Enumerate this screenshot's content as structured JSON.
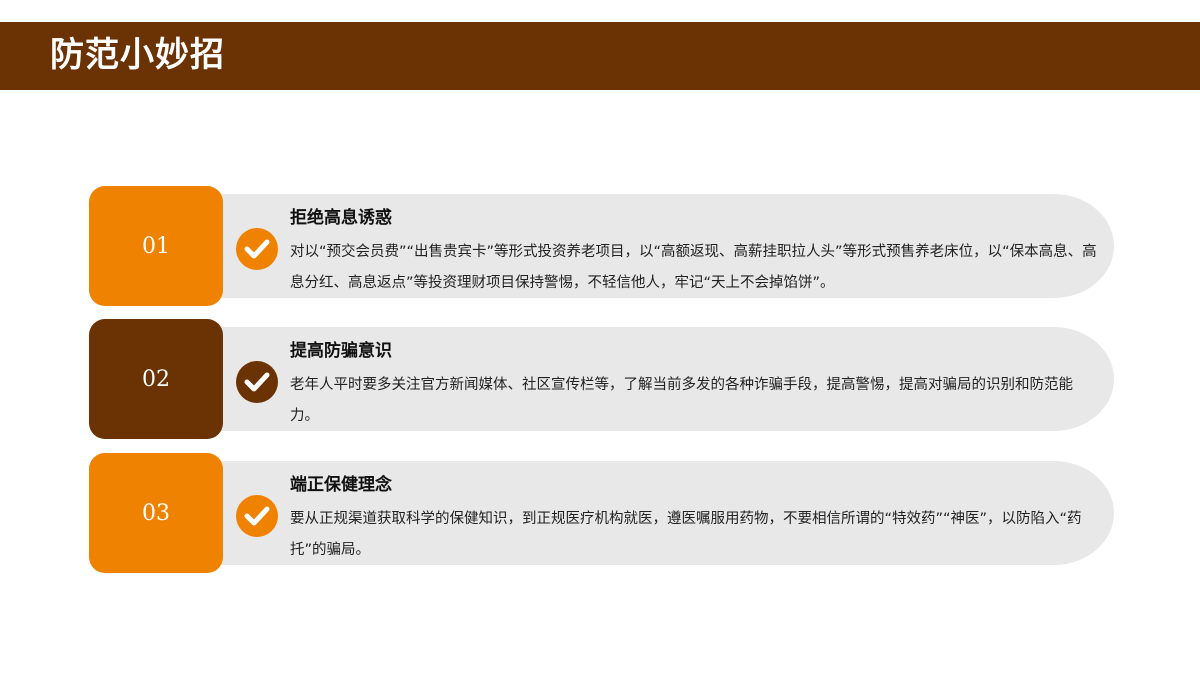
{
  "header": {
    "title": "防范小妙招"
  },
  "items": [
    {
      "number": "01",
      "title": "拒绝高息诱惑",
      "description": "对以“预交会员费”“出售贵宾卡”等形式投资养老项目，以“高额返现、高薪挂职拉人头”等形式预售养老床位，以“保本高息、高息分红、高息返点”等投资理财项目保持警惕，不轻信他人，牢记“天上不会掉馅饼”。",
      "color": "#ef8200",
      "icon": "check-circle-icon"
    },
    {
      "number": "02",
      "title": "提高防骗意识",
      "description": "老年人平时要多关注官方新闻媒体、社区宣传栏等，了解当前多发的各种诈骗手段，提高警惕，提高对骗局的识别和防范能力。",
      "color": "#6b3203",
      "icon": "check-circle-icon"
    },
    {
      "number": "03",
      "title": "端正保健理念",
      "description": "要从正规渠道获取科学的保健知识，到正规医疗机构就医，遵医嘱服用药物，不要相信所谓的“特效药”“神医”，以防陷入“药托”的骗局。",
      "color": "#ef8200",
      "icon": "check-circle-icon"
    }
  ]
}
